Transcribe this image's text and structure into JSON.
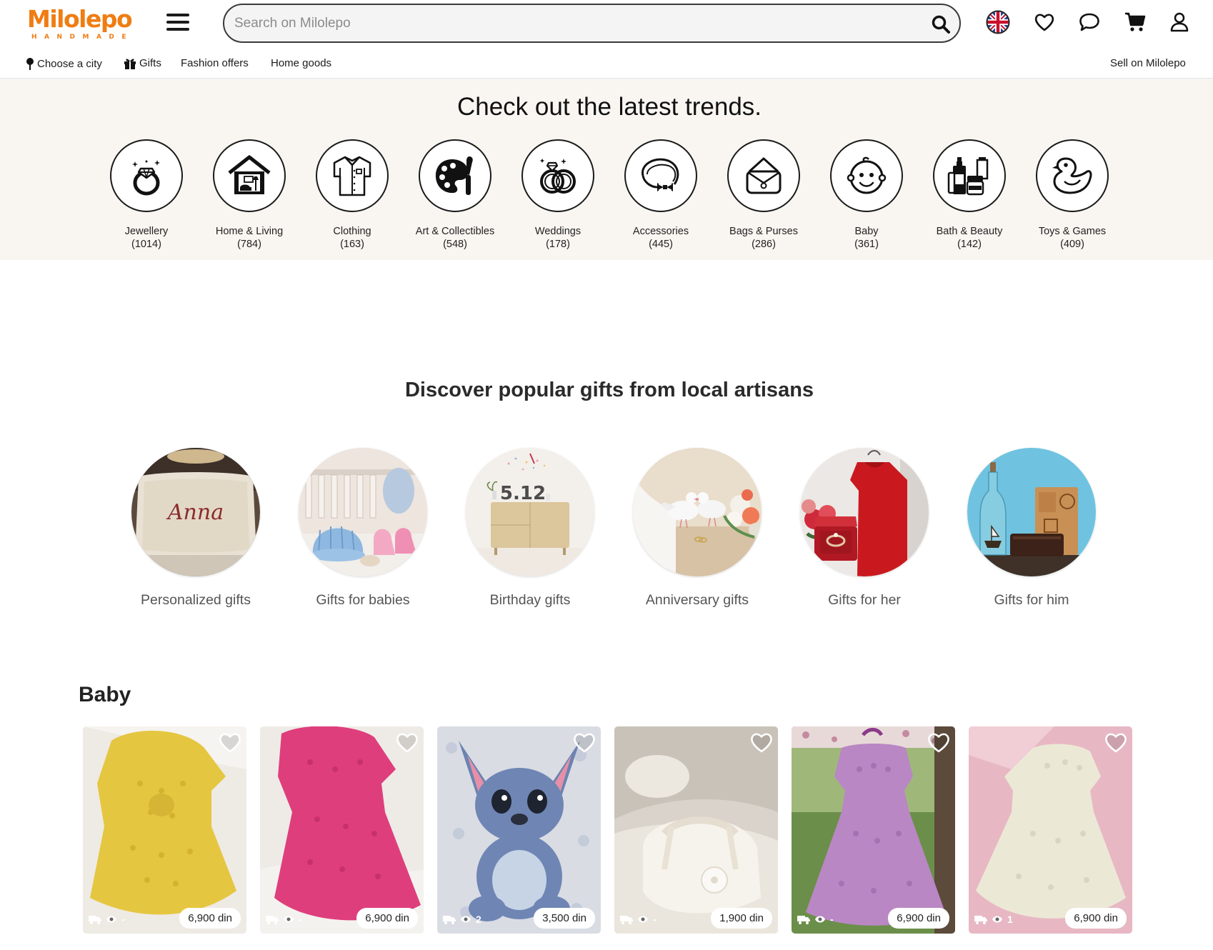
{
  "brand": {
    "name": "Milolepo",
    "tagline": "HANDMADE",
    "color": "#ef7d13"
  },
  "search": {
    "placeholder": "Search on Milolepo"
  },
  "header_icons": [
    "uk-flag-icon",
    "heart-icon",
    "chat-icon",
    "cart-icon",
    "user-icon"
  ],
  "subnav": {
    "choose_city": "Choose a city",
    "gifts": "Gifts",
    "fashion_offers": "Fashion offers",
    "home_goods": "Home goods",
    "sell": "Sell on Milolepo"
  },
  "trends": {
    "title": "Check out the latest trends.",
    "categories": [
      {
        "name": "Jewellery",
        "count": "(1014)",
        "icon": "ring-icon"
      },
      {
        "name": "Home & Living",
        "count": "(784)",
        "icon": "house-icon"
      },
      {
        "name": "Clothing",
        "count": "(163)",
        "icon": "shirt-icon"
      },
      {
        "name": "Art & Collectibles",
        "count": "(548)",
        "icon": "palette-icon"
      },
      {
        "name": "Weddings",
        "count": "(178)",
        "icon": "wedding-rings-icon"
      },
      {
        "name": "Accessories",
        "count": "(445)",
        "icon": "bowtie-headband-icon"
      },
      {
        "name": "Bags & Purses",
        "count": "(286)",
        "icon": "purse-icon"
      },
      {
        "name": "Baby",
        "count": "(361)",
        "icon": "baby-face-icon"
      },
      {
        "name": "Bath & Beauty",
        "count": "(142)",
        "icon": "cosmetics-icon"
      },
      {
        "name": "Toys & Games",
        "count": "(409)",
        "icon": "rubber-duck-icon"
      }
    ]
  },
  "gifts": {
    "title": "Discover popular gifts from local artisans",
    "items": [
      {
        "label": "Personalized gifts",
        "image_text": "Anna"
      },
      {
        "label": "Gifts for babies"
      },
      {
        "label": "Birthday gifts",
        "image_text": "5.12"
      },
      {
        "label": "Anniversary gifts"
      },
      {
        "label": "Gifts for her"
      },
      {
        "label": "Gifts for him"
      }
    ]
  },
  "baby": {
    "title": "Baby",
    "products": [
      {
        "price": "6,900 din",
        "views": "-",
        "subject": "yellow crochet dress",
        "color": "#e3c742"
      },
      {
        "price": "6,900 din",
        "views": "-",
        "subject": "pink crochet dress",
        "color": "#dd3d7b"
      },
      {
        "price": "3,500 din",
        "views": "2",
        "subject": "blue plush toy",
        "color": "#6f86b4"
      },
      {
        "price": "1,900 din",
        "views": "-",
        "subject": "white baby shoes",
        "color": "#f3efe6"
      },
      {
        "price": "6,900 din",
        "views": "-",
        "subject": "purple crochet dress",
        "color": "#b985c1"
      },
      {
        "price": "6,900 din",
        "views": "1",
        "subject": "cream crochet dress",
        "color": "#ece7d4"
      }
    ]
  }
}
